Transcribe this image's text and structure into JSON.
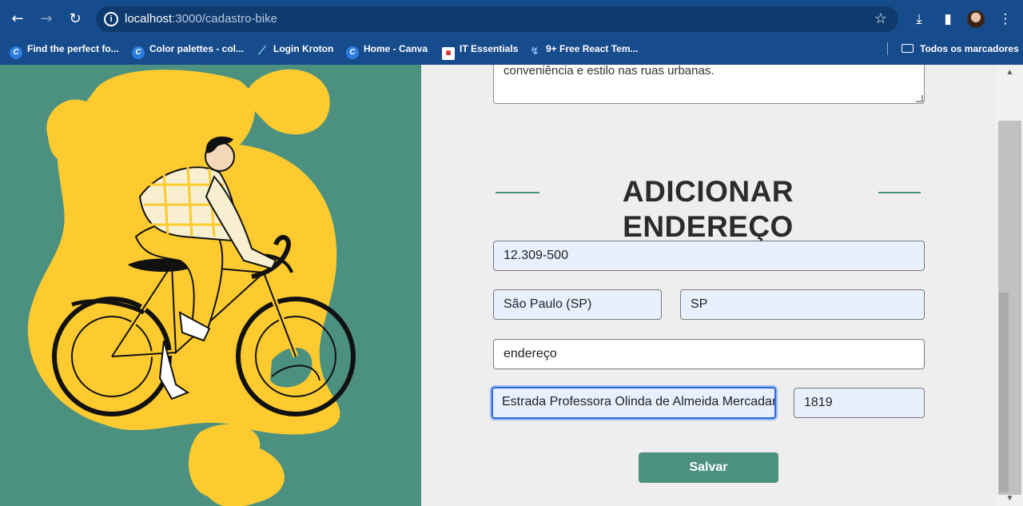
{
  "browser": {
    "url_host": "localhost",
    "url_path": ":3000/cadastro-bike",
    "bookmarks": [
      {
        "label": "Find the perfect fo...",
        "icon": "canva-icon"
      },
      {
        "label": "Color palettes - col...",
        "icon": "canva-icon"
      },
      {
        "label": "Login Kroton",
        "icon": "kroton-icon"
      },
      {
        "label": "Home - Canva",
        "icon": "canva-icon"
      },
      {
        "label": "IT Essentials",
        "icon": "cisco-icon"
      },
      {
        "label": "9+ Free React Tem...",
        "icon": "react-icon"
      }
    ],
    "all_bookmarks_label": "Todos os marcadores"
  },
  "form": {
    "description_value": "conveniência e estilo nas ruas urbanas.",
    "section_title": "ADICIONAR ENDEREÇO",
    "cep_value": "12.309-500",
    "city_value": "São Paulo (SP)",
    "state_value": "SP",
    "address_placeholder": "endereço",
    "street_value": "Estrada Professora Olinda de Almeida Mercadante",
    "number_value": "1819",
    "save_label": "Salvar"
  },
  "colors": {
    "accent": "#4c9080",
    "illustration_yellow": "#fdcb2f",
    "browser_chrome": "#174c8c"
  }
}
